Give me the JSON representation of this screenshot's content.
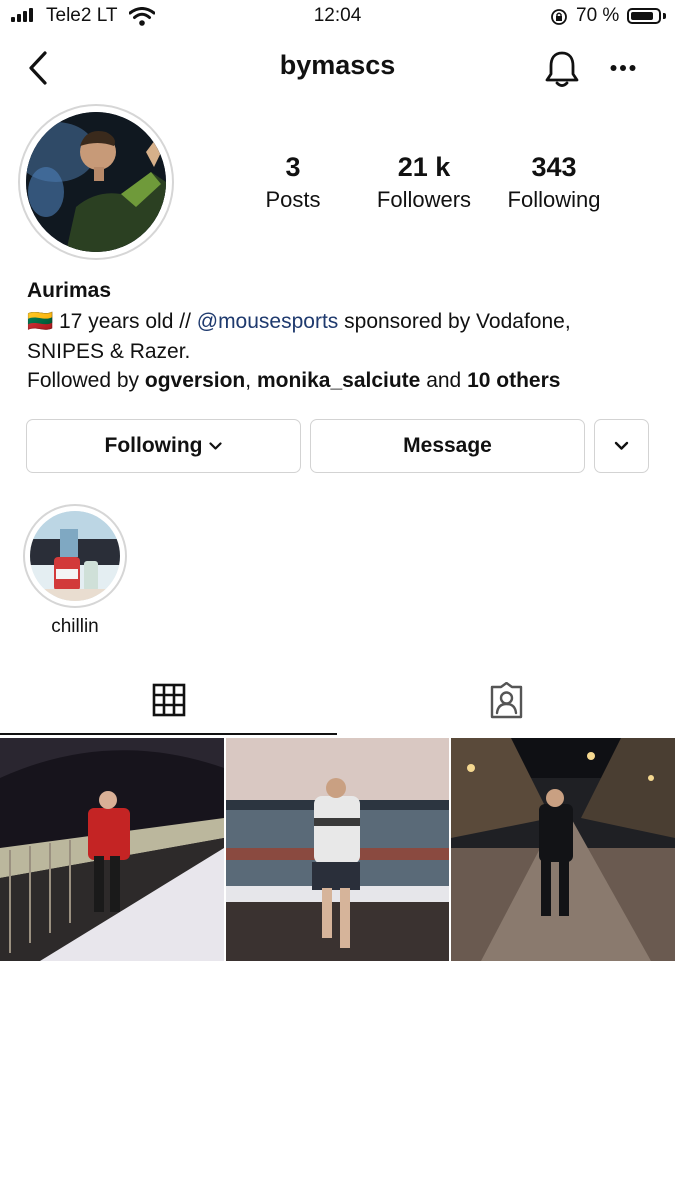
{
  "status_bar": {
    "carrier": "Tele2 LT",
    "time": "12:04",
    "battery_percent": "70 %"
  },
  "header": {
    "username": "bymascs"
  },
  "stats": [
    {
      "value": "3",
      "label": "Posts"
    },
    {
      "value": "21 k",
      "label": "Followers"
    },
    {
      "value": "343",
      "label": "Following"
    }
  ],
  "bio": {
    "name": "Aurimas",
    "line1_flag": "🇱🇹",
    "line1_text": "17 years old //",
    "line1_mention": "@mousesports",
    "line1_rest": "sponsored by Vodafone,",
    "line2": "SNIPES & Razer.",
    "followed_by_prefix": "Followed by",
    "followed_user1": "ogversion",
    "followed_sep": ",",
    "followed_user2": "monika_salciute",
    "followed_and": "and",
    "followed_others": "10 others"
  },
  "actions": {
    "following_label": "Following",
    "message_label": "Message"
  },
  "highlights": [
    {
      "label": "chillin"
    }
  ],
  "tabs": [
    {
      "icon": "grid-icon",
      "active": true
    },
    {
      "icon": "tagged-icon",
      "active": false
    }
  ],
  "colors": {
    "mention": "#1f3a6e",
    "border": "#d3d3d3"
  }
}
